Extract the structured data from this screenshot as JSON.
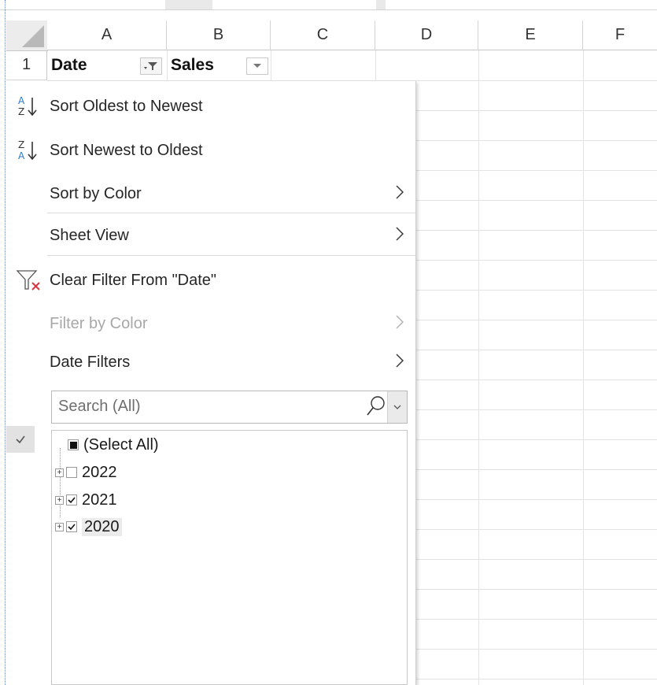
{
  "columns": [
    "A",
    "B",
    "C",
    "D",
    "E",
    "F"
  ],
  "row_number": "1",
  "cells": {
    "a1": "Date",
    "b1": "Sales"
  },
  "menu": {
    "items": [
      {
        "text": "Sort Oldest to Newest"
      },
      {
        "text": "Sort Newest to Oldest"
      },
      {
        "text": "Sort by Color"
      },
      {
        "text": "Sheet View"
      },
      {
        "text": "Clear Filter From \"Date\""
      },
      {
        "text": "Filter by Color",
        "disabled": true
      },
      {
        "text": "Date Filters"
      }
    ],
    "sort_asc_glyph": {
      "top": "A",
      "bottom": "Z"
    },
    "sort_desc_glyph": {
      "top": "Z",
      "bottom": "A"
    }
  },
  "search": {
    "placeholder": "Search (All)"
  },
  "tree": {
    "items": [
      {
        "label": "(Select All)",
        "state": "partial"
      },
      {
        "label": "2022",
        "state": "unchecked",
        "expandable": true
      },
      {
        "label": "2021",
        "state": "checked",
        "expandable": true
      },
      {
        "label": "2020",
        "state": "checked",
        "expandable": true
      }
    ]
  },
  "colors": {
    "accent_blue": "#2a78c6",
    "clear_filter_x": "#d9363e",
    "disabled_text": "#a8a8a8"
  },
  "icons": [
    "sort-asc-icon",
    "sort-desc-icon",
    "clear-filter-icon",
    "search-icon",
    "dropdown-arrow-icon",
    "filter-active-icon",
    "checkmark-icon",
    "chevron-right-icon",
    "plus-expand-icon"
  ]
}
